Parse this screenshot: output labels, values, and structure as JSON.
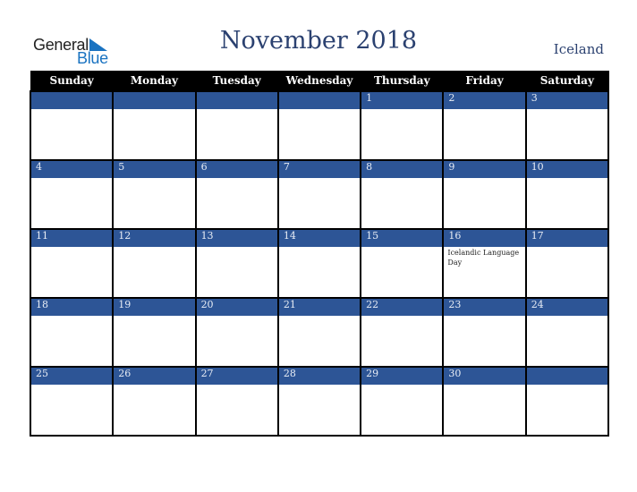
{
  "logo": {
    "general": "General",
    "blue": "Blue",
    "icon": "triangle-flag-icon",
    "accent_color": "#1a73c1"
  },
  "header": {
    "title": "November 2018",
    "country": "Iceland",
    "title_color": "#2b4170"
  },
  "colors": {
    "header_bg": "#000000",
    "week_bar": "#2d5596"
  },
  "weekdays": [
    "Sunday",
    "Monday",
    "Tuesday",
    "Wednesday",
    "Thursday",
    "Friday",
    "Saturday"
  ],
  "weeks": [
    {
      "days": [
        "",
        "",
        "",
        "",
        "1",
        "2",
        "3"
      ],
      "events": [
        "",
        "",
        "",
        "",
        "",
        "",
        ""
      ]
    },
    {
      "days": [
        "4",
        "5",
        "6",
        "7",
        "8",
        "9",
        "10"
      ],
      "events": [
        "",
        "",
        "",
        "",
        "",
        "",
        ""
      ]
    },
    {
      "days": [
        "11",
        "12",
        "13",
        "14",
        "15",
        "16",
        "17"
      ],
      "events": [
        "",
        "",
        "",
        "",
        "",
        "Icelandic Language Day",
        ""
      ]
    },
    {
      "days": [
        "18",
        "19",
        "20",
        "21",
        "22",
        "23",
        "24"
      ],
      "events": [
        "",
        "",
        "",
        "",
        "",
        "",
        ""
      ]
    },
    {
      "days": [
        "25",
        "26",
        "27",
        "28",
        "29",
        "30",
        ""
      ],
      "events": [
        "",
        "",
        "",
        "",
        "",
        "",
        ""
      ]
    }
  ]
}
